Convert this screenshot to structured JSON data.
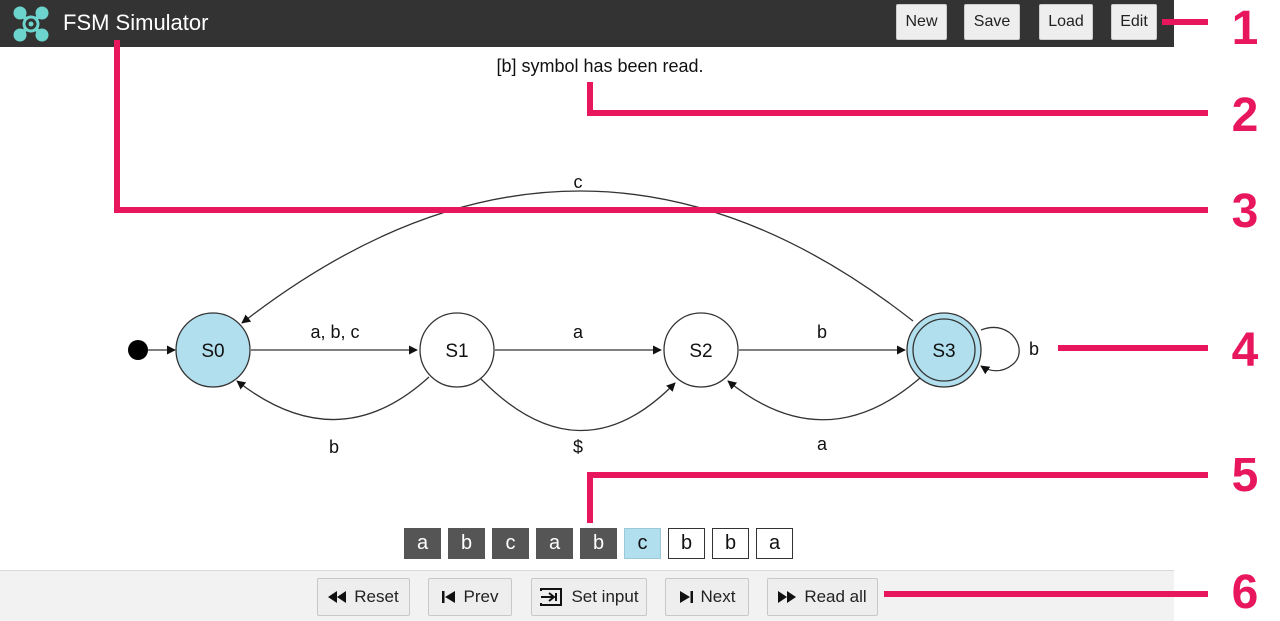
{
  "app": {
    "title": "FSM Simulator"
  },
  "toolbar": {
    "new_label": "New",
    "save_label": "Save",
    "load_label": "Load",
    "edit_label": "Edit"
  },
  "status": {
    "message": "[b] symbol has been read."
  },
  "fsm": {
    "states": [
      {
        "id": "S0",
        "label": "S0",
        "initial": true,
        "highlighted": true,
        "accepting": false
      },
      {
        "id": "S1",
        "label": "S1",
        "initial": false,
        "highlighted": false,
        "accepting": false
      },
      {
        "id": "S2",
        "label": "S2",
        "initial": false,
        "highlighted": false,
        "accepting": false
      },
      {
        "id": "S3",
        "label": "S3",
        "initial": false,
        "highlighted": true,
        "accepting": true
      }
    ],
    "transitions": [
      {
        "from": "S0",
        "to": "S1",
        "label": "a, b, c"
      },
      {
        "from": "S1",
        "to": "S0",
        "label": "b"
      },
      {
        "from": "S1",
        "to": "S2",
        "label": "a"
      },
      {
        "from": "S1",
        "to": "S2",
        "label": "$"
      },
      {
        "from": "S2",
        "to": "S3",
        "label": "b"
      },
      {
        "from": "S3",
        "to": "S2",
        "label": "a"
      },
      {
        "from": "S3",
        "to": "S0",
        "label": "c"
      },
      {
        "from": "S3",
        "to": "S3",
        "label": "b"
      }
    ]
  },
  "tape": {
    "cells": [
      {
        "symbol": "a",
        "status": "read"
      },
      {
        "symbol": "b",
        "status": "read"
      },
      {
        "symbol": "c",
        "status": "read"
      },
      {
        "symbol": "a",
        "status": "read"
      },
      {
        "symbol": "b",
        "status": "read"
      },
      {
        "symbol": "c",
        "status": "current"
      },
      {
        "symbol": "b",
        "status": "pending"
      },
      {
        "symbol": "b",
        "status": "pending"
      },
      {
        "symbol": "a",
        "status": "pending"
      }
    ]
  },
  "controls": {
    "reset_label": "Reset",
    "prev_label": "Prev",
    "set_input_label": "Set input",
    "next_label": "Next",
    "read_all_label": "Read all"
  },
  "callouts": [
    "1",
    "2",
    "3",
    "4",
    "5",
    "6"
  ],
  "colors": {
    "topbar": "#333333",
    "state_highlight": "#b2dfee",
    "tape_read": "#555555",
    "callout": "#e8175d",
    "logo": "#6cd4cc"
  },
  "icons": {
    "logo": "network-nodes-icon",
    "reset": "rewind-icon",
    "prev": "skip-back-icon",
    "set_input": "input-icon",
    "next": "skip-forward-icon",
    "read_all": "fast-forward-icon"
  }
}
